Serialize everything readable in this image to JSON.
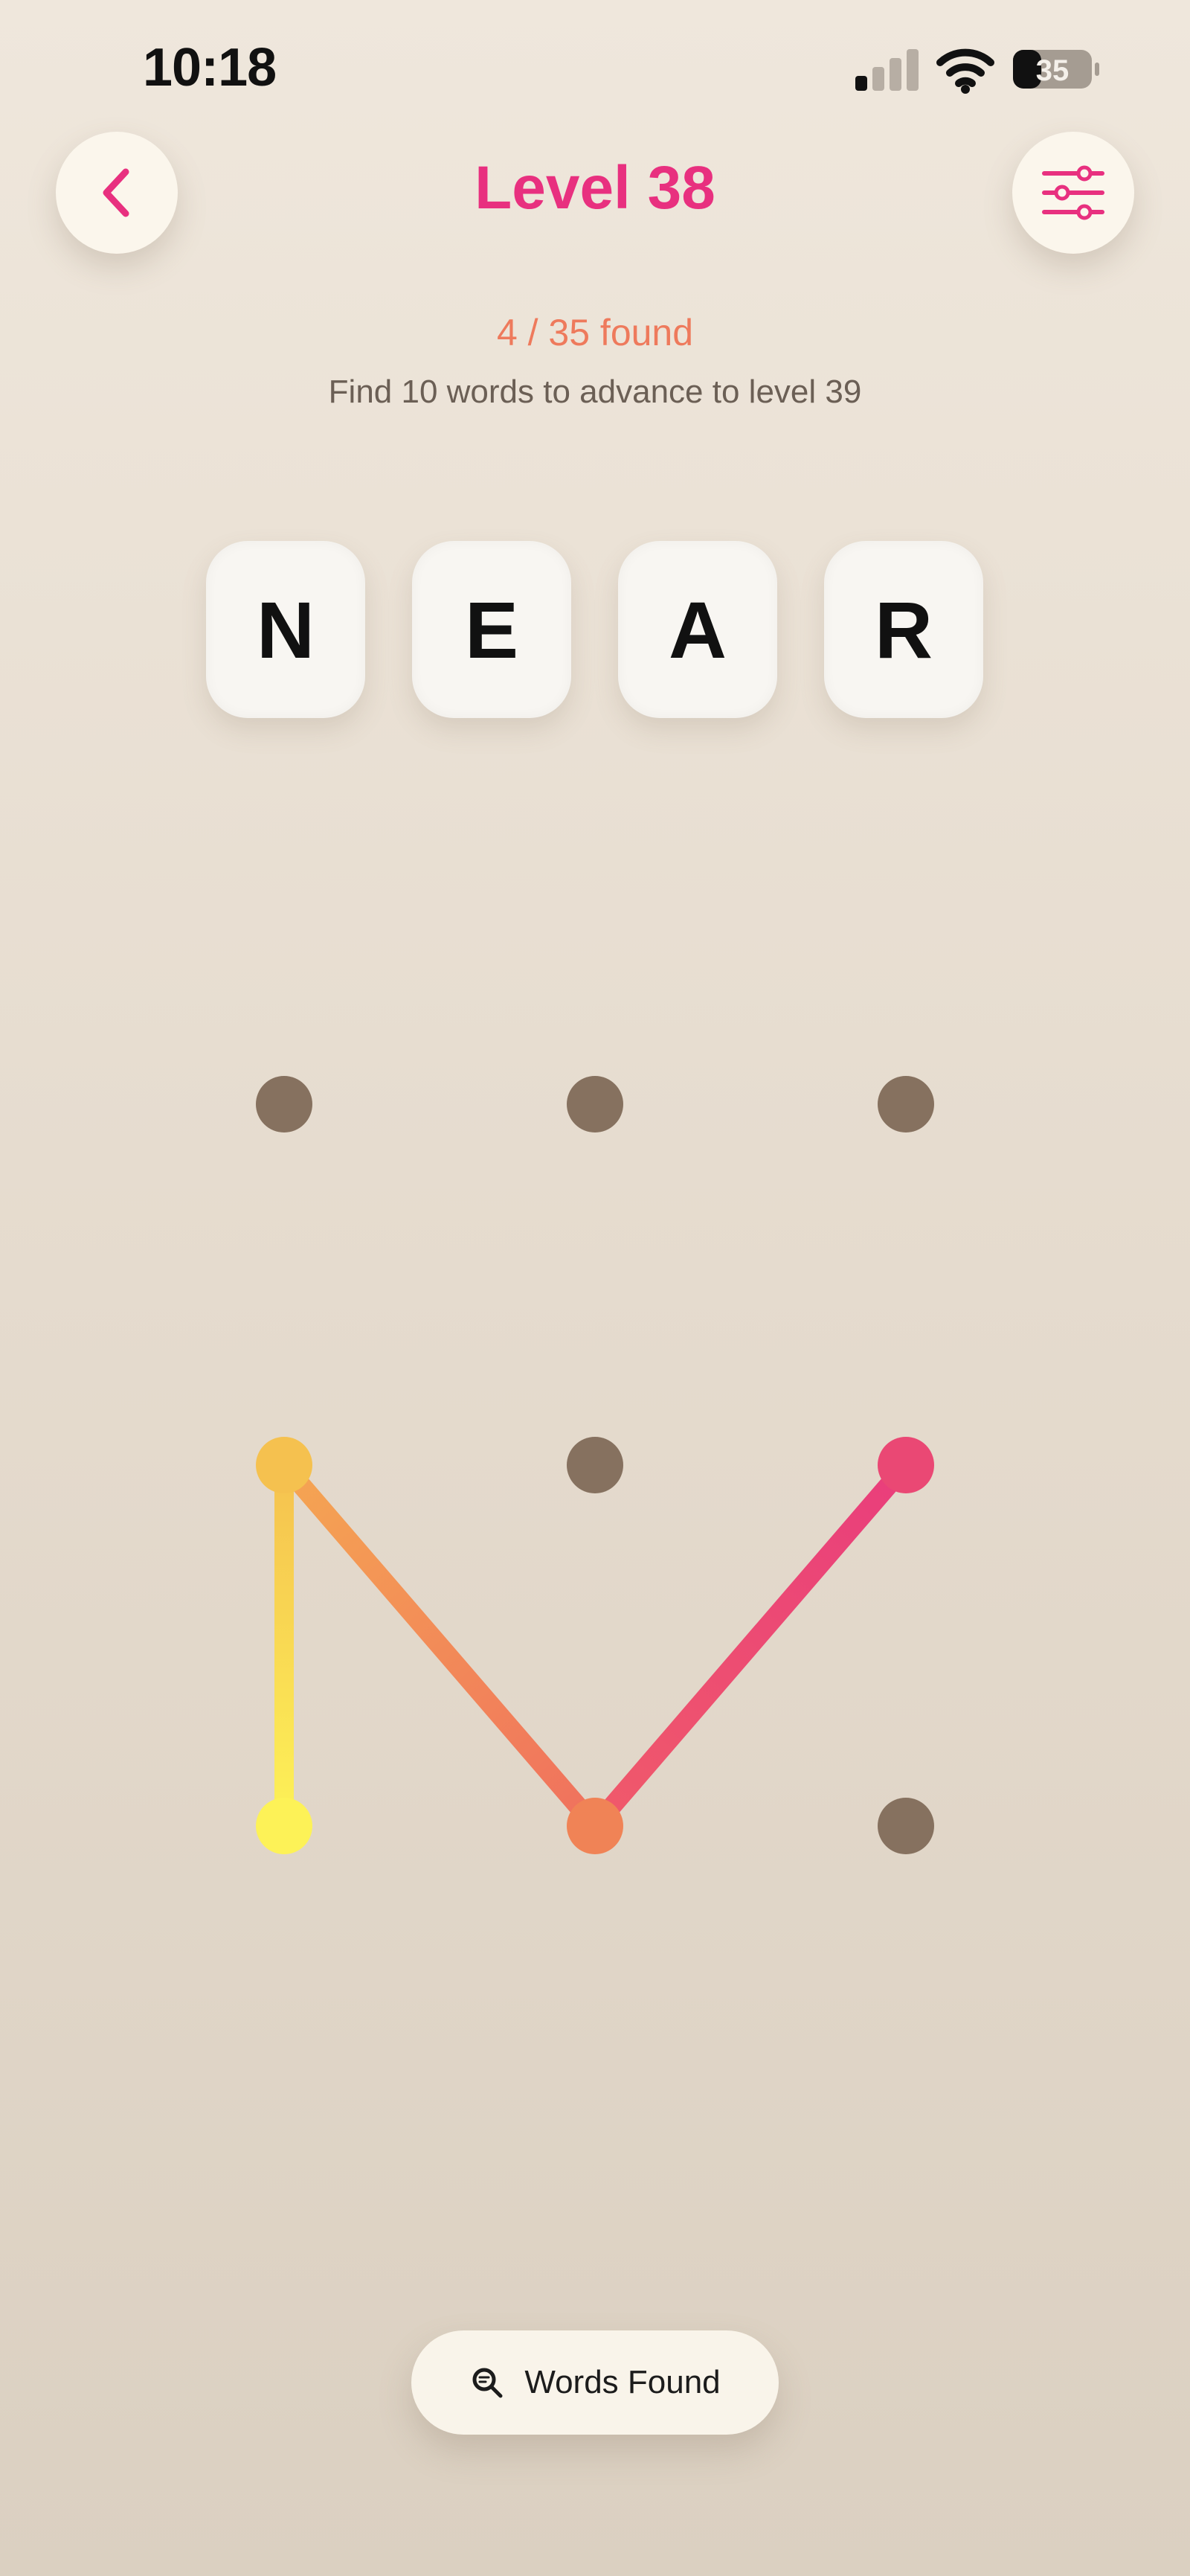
{
  "status_bar": {
    "time": "10:18",
    "battery_level": "35"
  },
  "header": {
    "title": "Level 38",
    "back_icon": "chevron-left-icon",
    "settings_icon": "sliders-icon"
  },
  "progress": {
    "found_text": "4 / 35 found",
    "instruction": "Find 10 words to advance to level 39"
  },
  "current_word": {
    "letters": [
      "N",
      "E",
      "A",
      "R"
    ]
  },
  "board": {
    "rows": 3,
    "cols": 3,
    "dot_color": "#86715f",
    "path": [
      {
        "row": 2,
        "col": 0,
        "color": "#fdf257"
      },
      {
        "row": 1,
        "col": 0,
        "color": "#f5c14f"
      },
      {
        "row": 2,
        "col": 1,
        "color": "#f08356"
      },
      {
        "row": 1,
        "col": 2,
        "color": "#ea4874"
      }
    ]
  },
  "footer": {
    "words_found_label": "Words Found",
    "icon": "search-icon"
  },
  "colors": {
    "accent": "#e8307f",
    "progress": "#ee7a5c"
  }
}
